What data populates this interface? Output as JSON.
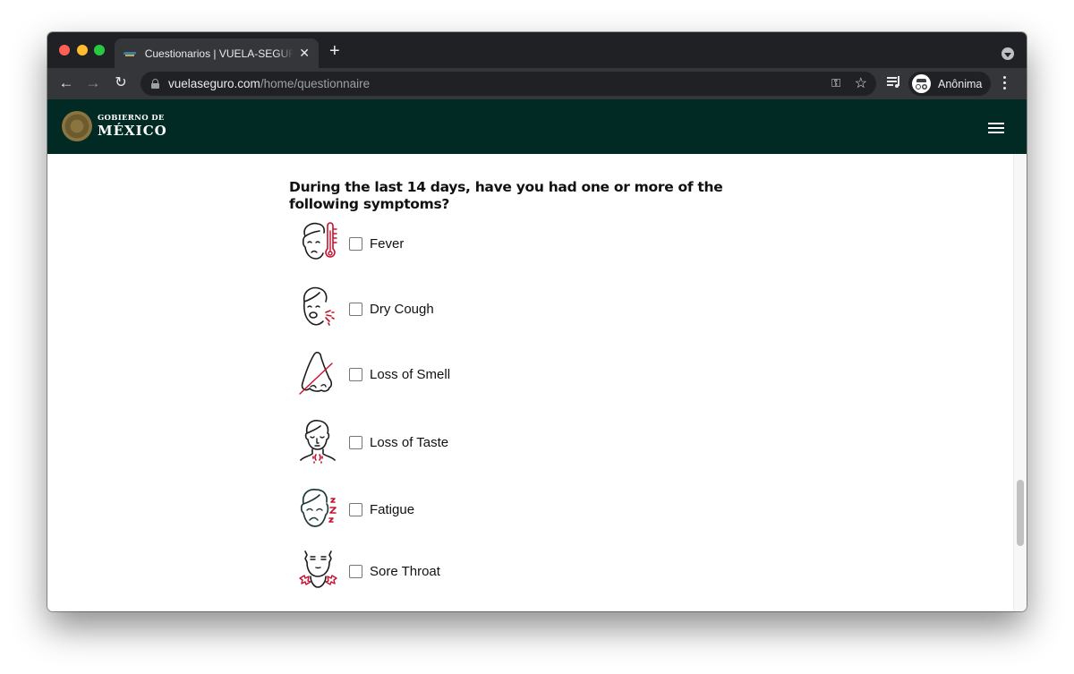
{
  "browser": {
    "tab": {
      "title": "Cuestionarios | VUELA-SEGURO",
      "favicon": "vuela-seguro-favicon"
    },
    "new_tab_label": "+",
    "tab_close_label": "✕",
    "url": {
      "host": "vuelaseguro.com",
      "path": "/home/questionnaire"
    },
    "nav": {
      "back": "←",
      "forward": "→",
      "reload": "↻"
    },
    "omnibox_icons": {
      "key": "⚿",
      "star": "☆"
    },
    "profile_label": "Anônima"
  },
  "header": {
    "logo_line1": "GOBIERNO DE",
    "logo_line2": "MÉXICO",
    "menu_icon": "hamburger-icon"
  },
  "questionnaire": {
    "question": "During the last 14 days, have you had one or more of the following symptoms?",
    "symptoms": [
      {
        "label": "Fever",
        "icon": "fever-icon",
        "checked": false
      },
      {
        "label": "Dry Cough",
        "icon": "dry-cough-icon",
        "checked": false
      },
      {
        "label": "Loss of Smell",
        "icon": "loss-of-smell-icon",
        "checked": false
      },
      {
        "label": "Loss of Taste",
        "icon": "loss-of-taste-icon",
        "checked": false
      },
      {
        "label": "Fatigue",
        "icon": "fatigue-icon",
        "checked": false
      },
      {
        "label": "Sore Throat",
        "icon": "sore-throat-icon",
        "checked": false
      }
    ]
  },
  "colors": {
    "header_bg": "#002a23",
    "accent_red": "#c8102e",
    "icon_stroke": "#1c1c1c",
    "fatigue_stroke": "#1f3d3a"
  }
}
